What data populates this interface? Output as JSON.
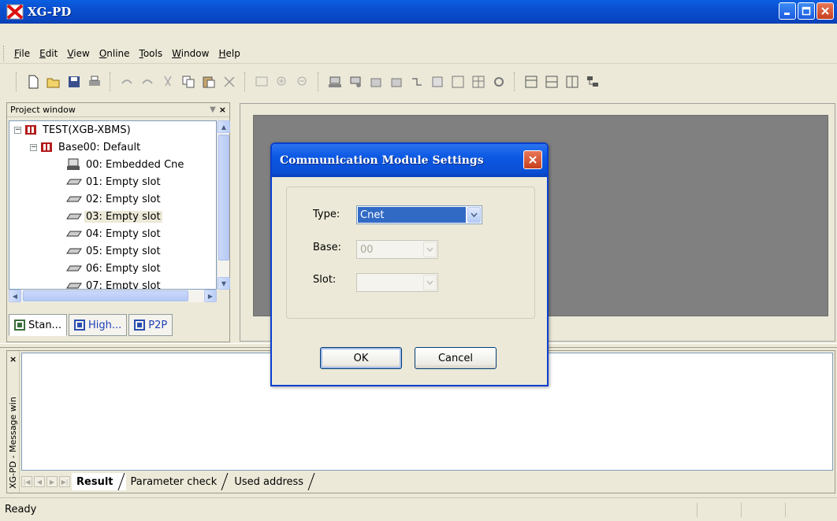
{
  "window": {
    "title": "XG-PD"
  },
  "menu": [
    {
      "pre": "",
      "u": "F",
      "post": "ile"
    },
    {
      "pre": "",
      "u": "E",
      "post": "dit"
    },
    {
      "pre": "",
      "u": "V",
      "post": "iew"
    },
    {
      "pre": "",
      "u": "O",
      "post": "nline"
    },
    {
      "pre": "",
      "u": "T",
      "post": "ools"
    },
    {
      "pre": "",
      "u": "W",
      "post": "indow"
    },
    {
      "pre": "",
      "u": "H",
      "post": "elp"
    }
  ],
  "project_window": {
    "title": "Project window",
    "tree": {
      "root": "TEST(XGB-XBMS)",
      "base": "Base00: Default",
      "slots": [
        "00: Embedded Cne",
        "01: Empty slot",
        "02: Empty slot",
        "03: Empty slot",
        "04: Empty slot",
        "05: Empty slot",
        "06: Empty slot",
        "07: Empty slot"
      ]
    },
    "tabs": [
      "Stan...",
      "High...",
      "P2P"
    ]
  },
  "dialog": {
    "title": "Communication Module Settings",
    "type_label": "Type:",
    "type_value": "Cnet",
    "base_label": "Base:",
    "base_value": "00",
    "slot_label": "Slot:",
    "slot_value": "",
    "ok": "OK",
    "cancel": "Cancel"
  },
  "message_window": {
    "title": "XG-PD - Message win",
    "tabs": [
      "Result",
      "Parameter check",
      "Used address"
    ]
  },
  "status": {
    "text": "Ready"
  },
  "colors": {
    "titlebar": "#0a4fd0",
    "selection": "#316ac5",
    "mdi_gray": "#808080"
  }
}
